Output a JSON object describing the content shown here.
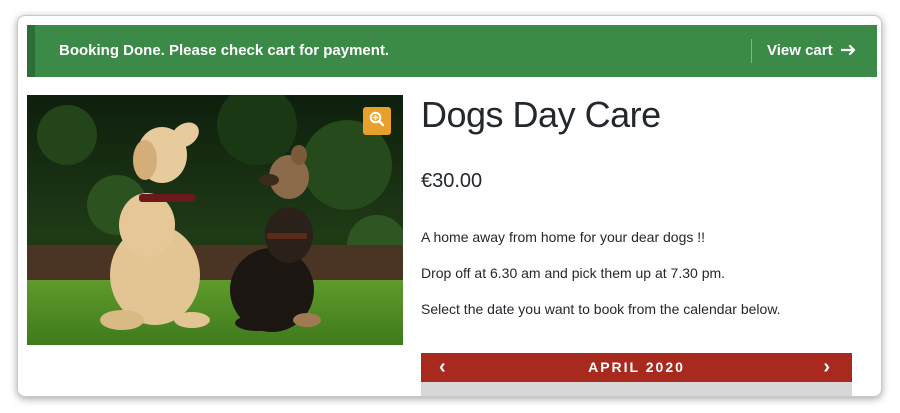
{
  "notice": {
    "message": "Booking Done. Please check cart for payment.",
    "view_cart_label": "View cart",
    "arrow_icon": "arrow-right-icon",
    "colors": {
      "background": "#3c8a48",
      "accent_border": "#2d6d37"
    }
  },
  "product": {
    "image_icon": "zoom-in-icon",
    "title": "Dogs Day Care",
    "price": "€30.00",
    "description": [
      "A home away from home for your dear dogs !!",
      "Drop off at 6.30 am and pick them up at 7.30 pm.",
      "Select the date you want to book from the calendar below."
    ]
  },
  "calendar": {
    "prev_label": "‹",
    "month_label": "APRIL 2020",
    "next_label": "›",
    "colors": {
      "header": "#a82a1e",
      "body": "#d7d7d7"
    }
  },
  "colors": {
    "zoom_button": "#e8a02c",
    "text": "#23282d"
  }
}
